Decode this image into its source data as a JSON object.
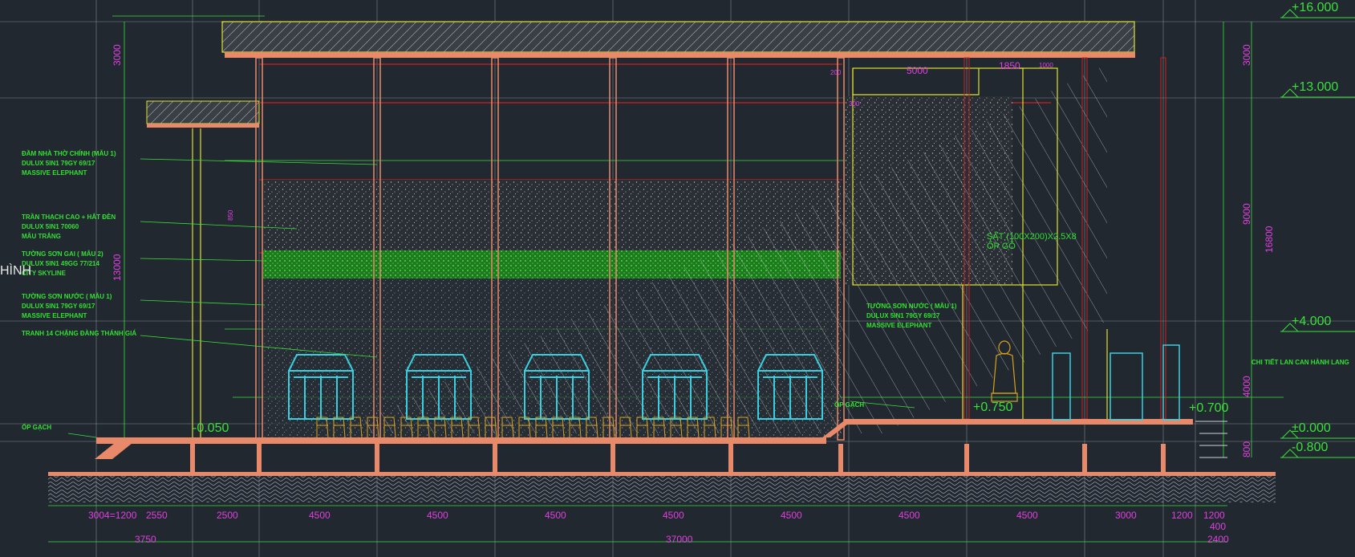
{
  "drawing": {
    "partial_title": "HÌNH",
    "level_marks": [
      "+16.000",
      "+13.000",
      "+4.000",
      "±0.000",
      "-0.800",
      "+0.700",
      "+0.750",
      "-0.050"
    ],
    "bottom_dims_row1": [
      "3004=1200",
      "2550",
      "2500",
      "4500",
      "4500",
      "4500",
      "4500",
      "4500",
      "4500",
      "4500",
      "3000",
      "1200",
      "1200"
    ],
    "bottom_dims_row2": [
      "3750",
      "37000",
      "2400"
    ],
    "bottom_extra": "400",
    "top_dims": [
      "200",
      "300",
      "5000",
      "1850",
      "1000"
    ],
    "right_vertical_dims": [
      "3000",
      "9000",
      "4000",
      "800",
      "16800"
    ],
    "left_vertical_dims": [
      "3000",
      "13000",
      "850"
    ],
    "annotations_left": [
      [
        "ĐẦM NHÀ THỜ CHÍNH (MẪU 1)",
        "DULUX 5IN1 79GY 69/17",
        "MASSIVE ELEPHANT"
      ],
      [
        "TRẦN THẠCH CAO + HẮT ĐÈN",
        "DULUX 5IN1 70060",
        "MẪU TRẮNG"
      ],
      [
        "TƯỜNG SƠN GAI ( MẪU 2)",
        "DULUX 5IN1 49GG 77/214",
        "CITY SKYLINE"
      ],
      [
        "TƯỜNG SƠN NƯỚC ( MẪU 1)",
        "DULUX 5IN1 79GY 69/17",
        "MASSIVE ELEPHANT"
      ],
      [
        "TRANH 14 CHẶNG ĐÀNG THÁNH GIÁ"
      ],
      [
        "ỐP GẠCH"
      ]
    ],
    "annotations_right": [
      [
        "TƯỜNG SƠN NƯỚC ( MẪU 1)",
        "DULUX 5IN1 79GY 69/17",
        "MASSIVE ELEPHANT"
      ],
      [
        "ỐP GẠCH"
      ],
      [
        "SẮT (100X200)X2.5X8",
        "ỐP GỖ"
      ],
      [
        "CHI TIẾT LAN CAN HÀNH LANG"
      ]
    ],
    "colors": {
      "background": "#212830",
      "dimension": "#e040e0",
      "note": "#33e033",
      "column": "#e88a6a",
      "window": "#38d0e0",
      "grid": "#cfd4da",
      "outline": "#e0e030",
      "beam": "#d02020"
    }
  }
}
